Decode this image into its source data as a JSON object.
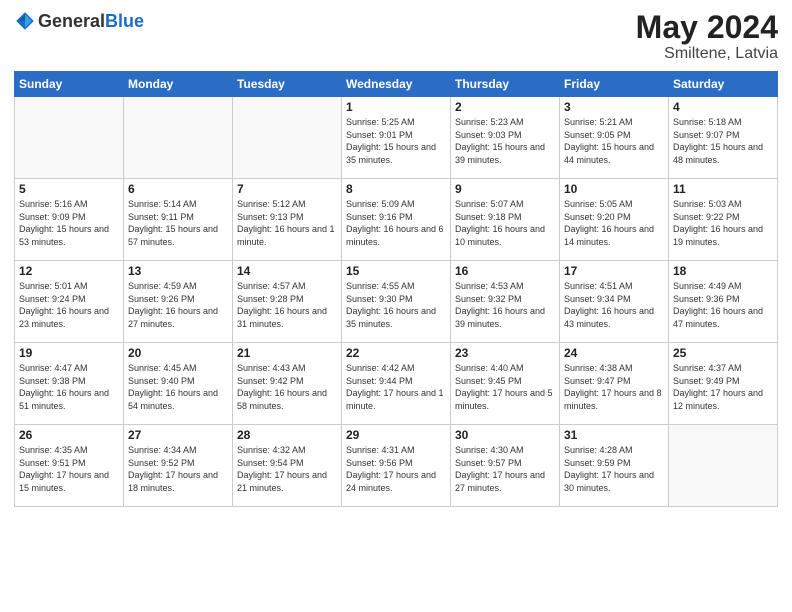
{
  "logo": {
    "general": "General",
    "blue": "Blue"
  },
  "title": {
    "month_year": "May 2024",
    "location": "Smiltene, Latvia"
  },
  "days_of_week": [
    "Sunday",
    "Monday",
    "Tuesday",
    "Wednesday",
    "Thursday",
    "Friday",
    "Saturday"
  ],
  "weeks": [
    [
      {
        "day": "",
        "info": ""
      },
      {
        "day": "",
        "info": ""
      },
      {
        "day": "",
        "info": ""
      },
      {
        "day": "1",
        "info": "Sunrise: 5:25 AM\nSunset: 9:01 PM\nDaylight: 15 hours\nand 35 minutes."
      },
      {
        "day": "2",
        "info": "Sunrise: 5:23 AM\nSunset: 9:03 PM\nDaylight: 15 hours\nand 39 minutes."
      },
      {
        "day": "3",
        "info": "Sunrise: 5:21 AM\nSunset: 9:05 PM\nDaylight: 15 hours\nand 44 minutes."
      },
      {
        "day": "4",
        "info": "Sunrise: 5:18 AM\nSunset: 9:07 PM\nDaylight: 15 hours\nand 48 minutes."
      }
    ],
    [
      {
        "day": "5",
        "info": "Sunrise: 5:16 AM\nSunset: 9:09 PM\nDaylight: 15 hours\nand 53 minutes."
      },
      {
        "day": "6",
        "info": "Sunrise: 5:14 AM\nSunset: 9:11 PM\nDaylight: 15 hours\nand 57 minutes."
      },
      {
        "day": "7",
        "info": "Sunrise: 5:12 AM\nSunset: 9:13 PM\nDaylight: 16 hours\nand 1 minute."
      },
      {
        "day": "8",
        "info": "Sunrise: 5:09 AM\nSunset: 9:16 PM\nDaylight: 16 hours\nand 6 minutes."
      },
      {
        "day": "9",
        "info": "Sunrise: 5:07 AM\nSunset: 9:18 PM\nDaylight: 16 hours\nand 10 minutes."
      },
      {
        "day": "10",
        "info": "Sunrise: 5:05 AM\nSunset: 9:20 PM\nDaylight: 16 hours\nand 14 minutes."
      },
      {
        "day": "11",
        "info": "Sunrise: 5:03 AM\nSunset: 9:22 PM\nDaylight: 16 hours\nand 19 minutes."
      }
    ],
    [
      {
        "day": "12",
        "info": "Sunrise: 5:01 AM\nSunset: 9:24 PM\nDaylight: 16 hours\nand 23 minutes."
      },
      {
        "day": "13",
        "info": "Sunrise: 4:59 AM\nSunset: 9:26 PM\nDaylight: 16 hours\nand 27 minutes."
      },
      {
        "day": "14",
        "info": "Sunrise: 4:57 AM\nSunset: 9:28 PM\nDaylight: 16 hours\nand 31 minutes."
      },
      {
        "day": "15",
        "info": "Sunrise: 4:55 AM\nSunset: 9:30 PM\nDaylight: 16 hours\nand 35 minutes."
      },
      {
        "day": "16",
        "info": "Sunrise: 4:53 AM\nSunset: 9:32 PM\nDaylight: 16 hours\nand 39 minutes."
      },
      {
        "day": "17",
        "info": "Sunrise: 4:51 AM\nSunset: 9:34 PM\nDaylight: 16 hours\nand 43 minutes."
      },
      {
        "day": "18",
        "info": "Sunrise: 4:49 AM\nSunset: 9:36 PM\nDaylight: 16 hours\nand 47 minutes."
      }
    ],
    [
      {
        "day": "19",
        "info": "Sunrise: 4:47 AM\nSunset: 9:38 PM\nDaylight: 16 hours\nand 51 minutes."
      },
      {
        "day": "20",
        "info": "Sunrise: 4:45 AM\nSunset: 9:40 PM\nDaylight: 16 hours\nand 54 minutes."
      },
      {
        "day": "21",
        "info": "Sunrise: 4:43 AM\nSunset: 9:42 PM\nDaylight: 16 hours\nand 58 minutes."
      },
      {
        "day": "22",
        "info": "Sunrise: 4:42 AM\nSunset: 9:44 PM\nDaylight: 17 hours\nand 1 minute."
      },
      {
        "day": "23",
        "info": "Sunrise: 4:40 AM\nSunset: 9:45 PM\nDaylight: 17 hours\nand 5 minutes."
      },
      {
        "day": "24",
        "info": "Sunrise: 4:38 AM\nSunset: 9:47 PM\nDaylight: 17 hours\nand 8 minutes."
      },
      {
        "day": "25",
        "info": "Sunrise: 4:37 AM\nSunset: 9:49 PM\nDaylight: 17 hours\nand 12 minutes."
      }
    ],
    [
      {
        "day": "26",
        "info": "Sunrise: 4:35 AM\nSunset: 9:51 PM\nDaylight: 17 hours\nand 15 minutes."
      },
      {
        "day": "27",
        "info": "Sunrise: 4:34 AM\nSunset: 9:52 PM\nDaylight: 17 hours\nand 18 minutes."
      },
      {
        "day": "28",
        "info": "Sunrise: 4:32 AM\nSunset: 9:54 PM\nDaylight: 17 hours\nand 21 minutes."
      },
      {
        "day": "29",
        "info": "Sunrise: 4:31 AM\nSunset: 9:56 PM\nDaylight: 17 hours\nand 24 minutes."
      },
      {
        "day": "30",
        "info": "Sunrise: 4:30 AM\nSunset: 9:57 PM\nDaylight: 17 hours\nand 27 minutes."
      },
      {
        "day": "31",
        "info": "Sunrise: 4:28 AM\nSunset: 9:59 PM\nDaylight: 17 hours\nand 30 minutes."
      },
      {
        "day": "",
        "info": ""
      }
    ]
  ]
}
